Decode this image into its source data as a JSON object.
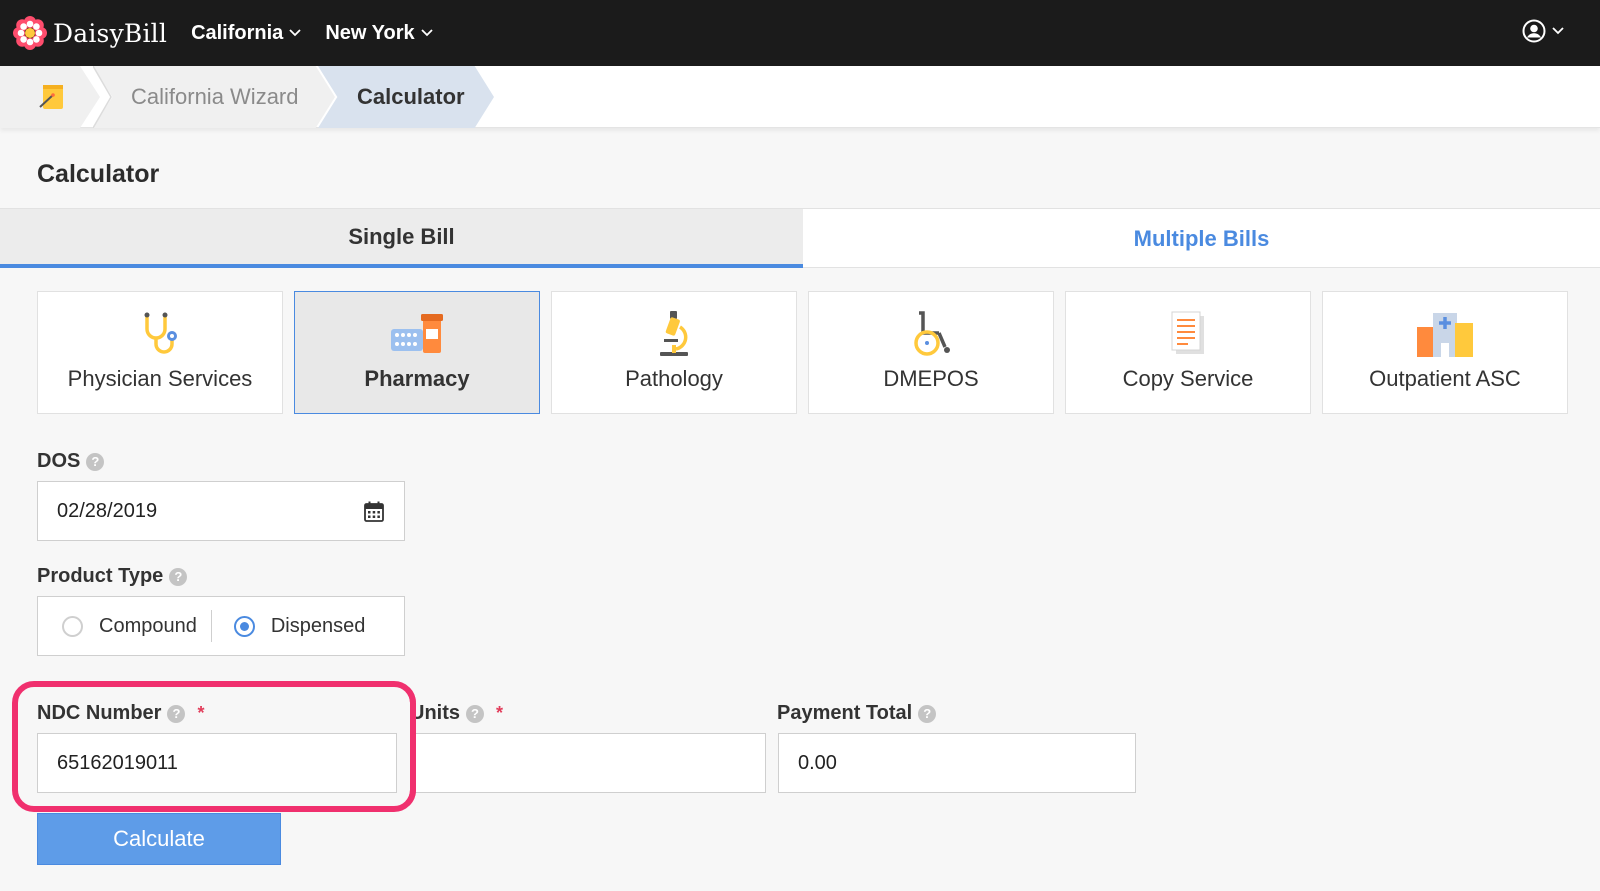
{
  "header": {
    "brand": "DaisyBill",
    "nav": [
      {
        "label": "California"
      },
      {
        "label": "New York"
      }
    ]
  },
  "breadcrumb": {
    "items": [
      "California Wizard",
      "Calculator"
    ]
  },
  "page": {
    "title": "Calculator"
  },
  "tabs": {
    "single": "Single Bill",
    "multiple": "Multiple Bills",
    "active": "single"
  },
  "services": [
    {
      "label": "Physician Services",
      "icon": "stethoscope-icon"
    },
    {
      "label": "Pharmacy",
      "icon": "pharmacy-icon",
      "selected": true
    },
    {
      "label": "Pathology",
      "icon": "microscope-icon"
    },
    {
      "label": "DMEPOS",
      "icon": "wheelchair-icon"
    },
    {
      "label": "Copy Service",
      "icon": "document-icon"
    },
    {
      "label": "Outpatient ASC",
      "icon": "hospital-icon"
    }
  ],
  "form": {
    "dos": {
      "label": "DOS",
      "value": "02/28/2019"
    },
    "product_type": {
      "label": "Product Type",
      "options": [
        "Compound",
        "Dispensed"
      ],
      "selected": "Dispensed"
    },
    "ndc": {
      "label": "NDC Number",
      "required": "*",
      "value": "65162019011"
    },
    "units": {
      "label": "Units",
      "required": "*",
      "value": ""
    },
    "payment_total": {
      "label": "Payment Total",
      "value": "0.00"
    },
    "help_glyph": "?",
    "calculate": "Calculate"
  },
  "colors": {
    "accent": "#4a8ae0",
    "topbar": "#1b1b1b",
    "highlight": "#f0306e"
  }
}
